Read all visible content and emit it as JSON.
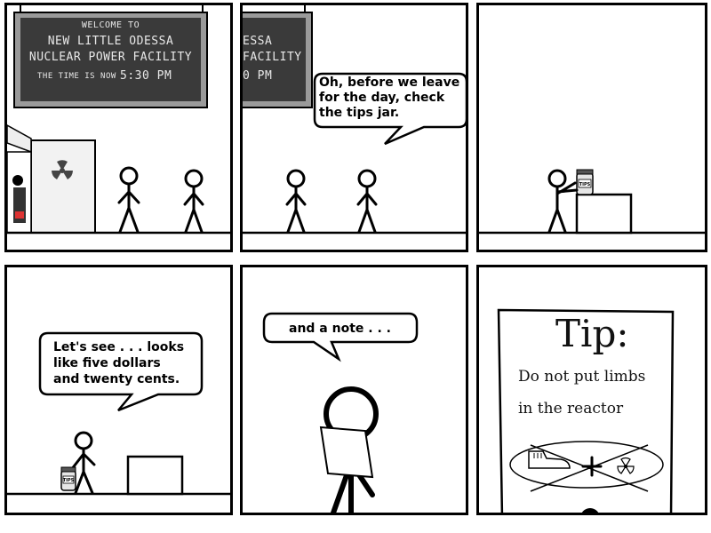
{
  "panels": [
    {
      "sign": {
        "welcome": "WELCOME TO",
        "line1": "NEW LITTLE ODESSA",
        "line2": "NUCLEAR POWER FACILITY",
        "time_label": "THE TIME IS NOW",
        "time_value": "5:30 PM"
      }
    },
    {
      "sign": {
        "line1": "ESSA",
        "line2": "FACILITY",
        "time_value": "0 PM"
      },
      "bubble": {
        "line1": "Oh, before we leave",
        "line2": "for the day, check",
        "line3": "the tips jar."
      }
    },
    {
      "jar_label": "TIPS"
    },
    {
      "bubble": {
        "line1": "Let's see . . . looks",
        "line2": "like five dollars",
        "line3": "and twenty cents."
      },
      "jar_label": "TIPS"
    },
    {
      "bubble": {
        "line1": "and a note . . ."
      }
    },
    {
      "note": {
        "title": "Tip:",
        "line1": "Do not put limbs",
        "line2": "in the reactor"
      }
    }
  ],
  "colors": {
    "ink": "#000000",
    "sign_bg": "#3a3a3a",
    "sign_frame": "#9a9a9a",
    "radiation": "#444444"
  }
}
